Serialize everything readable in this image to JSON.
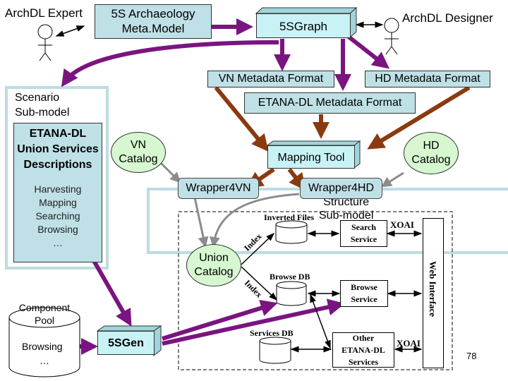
{
  "slide": {
    "page_number": "78"
  },
  "actors": {
    "expert": "ArchDL Expert",
    "designer": "ArchDL Designer"
  },
  "models": {
    "meta_model": [
      "5S Archaeology",
      "Meta.Model"
    ],
    "graph_tool": "5SGraph",
    "gen_tool": "5SGen",
    "mapping_tool": "Mapping Tool"
  },
  "formats": {
    "vn": "VN Metadata Format",
    "hd": "HD Metadata Format",
    "etana": "ETANA-DL Metadata Format"
  },
  "scenario": {
    "title": [
      "Scenario",
      "Sub-model"
    ],
    "note_title": [
      "ETANA-DL",
      "Union Services",
      "Descriptions"
    ],
    "items": [
      "Harvesting",
      "Mapping",
      "Searching",
      "Browsing",
      "…"
    ]
  },
  "structure": {
    "title": [
      "Structure",
      "Sub-model"
    ]
  },
  "catalogs": {
    "vn": [
      "VN",
      "Catalog"
    ],
    "hd": [
      "HD",
      "Catalog"
    ],
    "union": [
      "Union",
      "Catalog"
    ]
  },
  "wrappers": {
    "vn": "Wrapper4VN",
    "hd": "Wrapper4HD"
  },
  "component_pool": {
    "title": [
      "Component",
      "Pool"
    ],
    "items": [
      "Browsing",
      "…"
    ]
  },
  "system": {
    "inverted_files": "Inverted Files",
    "browse_db": "Browse DB",
    "services_db": "Services DB",
    "index_label_1": "Index",
    "index_label_2": "Index",
    "search_service": [
      "Search",
      "Service"
    ],
    "browse_service": [
      "Browse",
      "Service"
    ],
    "other_services": [
      "Other",
      "ETANA-DL",
      "Services"
    ],
    "xoai_1": "XOAI",
    "xoai_2": "XOAI",
    "web_interface": "Web Interface"
  },
  "colors": {
    "purple_arrow": "#7a1480",
    "brown_arrow": "#8b3a10",
    "gray_arrow": "#8c8c8c",
    "note_fill": "#bfe0e6",
    "box3d_fill": "#c8f2f6",
    "ellipse_fill": "#d6f7d0",
    "frame": "#bcdde2"
  }
}
